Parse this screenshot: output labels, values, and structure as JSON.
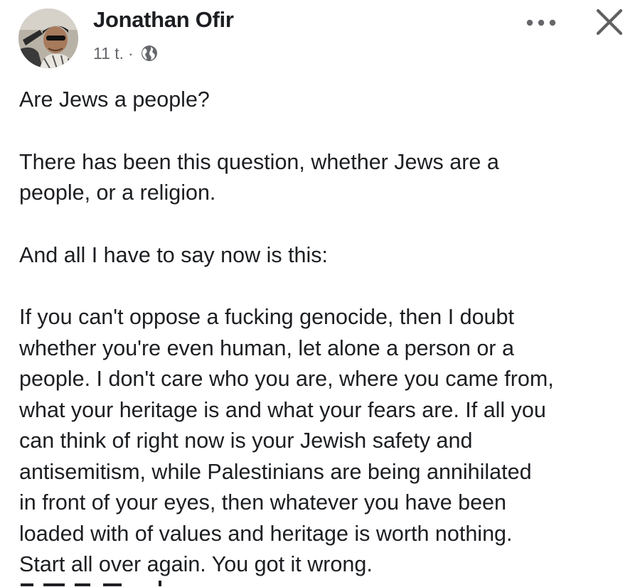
{
  "post": {
    "author": {
      "name": "Jonathan Ofir",
      "avatar_icon": "profile-photo"
    },
    "meta": {
      "timestamp": "11 t.",
      "separator": "·",
      "audience_icon": "globe-icon"
    },
    "actions": {
      "more_icon": "more-options-icon",
      "close_icon": "close-icon"
    },
    "paragraphs": [
      {
        "lines": [
          "Are Jews a people?"
        ]
      },
      {
        "lines": [
          "There has been this question, whether Jews are a",
          "people, or a religion."
        ]
      },
      {
        "lines": [
          "And all I have to say now is this:"
        ]
      },
      {
        "lines": [
          "If you can't oppose a fucking genocide, then I doubt",
          "whether you're even human, let alone a person or a",
          "people. I don't care who you are, where you came from,",
          "what your heritage is and what your fears are. If all you",
          "can think of right now is your Jewish safety and",
          "antisemitism, while Palestinians are being annihilated",
          "in front of your eyes, then whatever you have been",
          "loaded with of values and heritage is worth nothing.",
          "Start all over again. You got it wrong."
        ]
      }
    ]
  },
  "colors": {
    "text_primary": "#1c1e21",
    "text_secondary": "#65676b",
    "background": "#ffffff"
  }
}
